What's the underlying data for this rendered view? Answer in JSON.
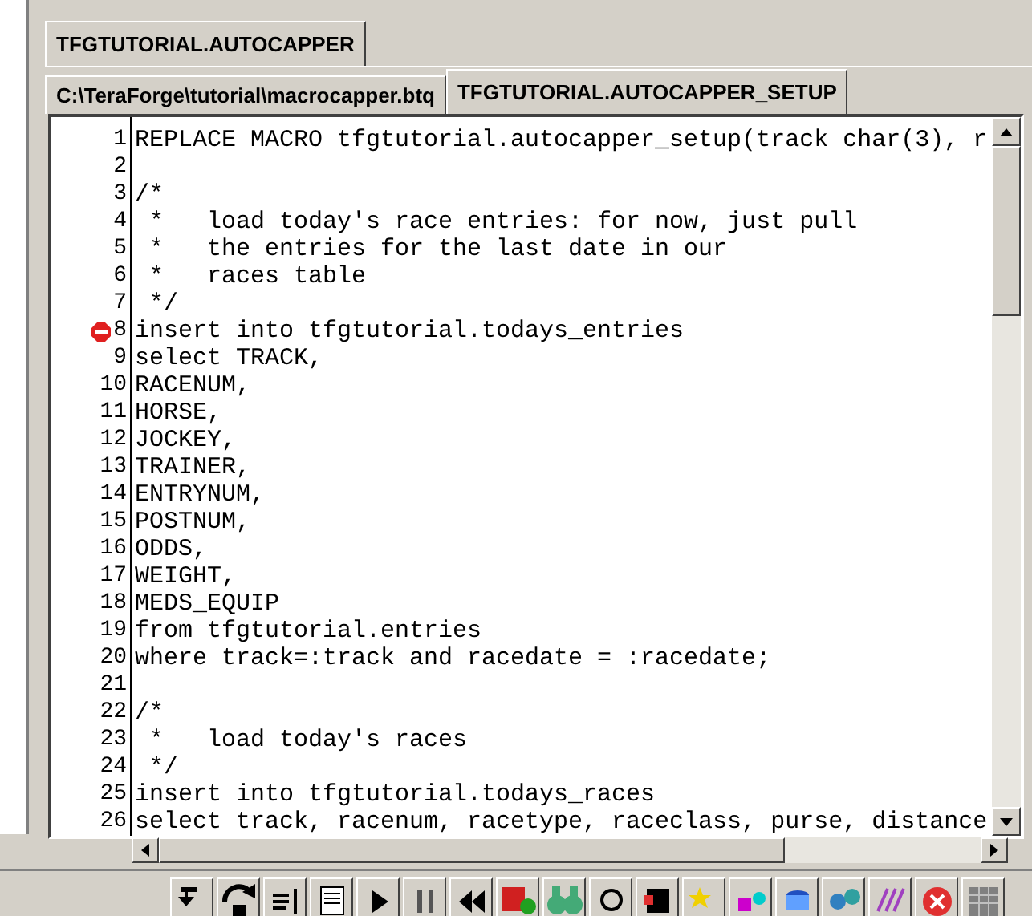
{
  "outer_tabs": [
    {
      "label": "TFGTUTORIAL.AUTOCAPPER",
      "selected": true
    }
  ],
  "editor_tabs": [
    {
      "label": "C:\\TeraForge\\tutorial\\macrocapper.btq",
      "selected": false
    },
    {
      "label": "TFGTUTORIAL.AUTOCAPPER_SETUP",
      "selected": true
    }
  ],
  "lines": [
    {
      "number": "1",
      "text": "REPLACE MACRO tfgtutorial.autocapper_setup(track char(3), r",
      "breakpoint": false
    },
    {
      "number": "2",
      "breakpoint": false
    },
    {
      "number": "3",
      "text": "/*",
      "breakpoint": false
    },
    {
      "number": "4",
      "text": " *   load today's race entries: for now, just pull",
      "breakpoint": false
    },
    {
      "number": "5",
      "text": " *   the entries for the last date in our",
      "breakpoint": false
    },
    {
      "number": "6",
      "text": " *   races table",
      "breakpoint": false
    },
    {
      "number": "7",
      "text": " */",
      "breakpoint": false
    },
    {
      "number": "8",
      "text": "insert into tfgtutorial.todays_entries",
      "breakpoint": true
    },
    {
      "number": "9",
      "text": "select TRACK,",
      "breakpoint": false
    },
    {
      "number": "10",
      "text": "RACENUM,",
      "breakpoint": false
    },
    {
      "number": "11",
      "text": "HORSE,",
      "breakpoint": false
    },
    {
      "number": "12",
      "text": "JOCKEY,",
      "breakpoint": false
    },
    {
      "number": "13",
      "text": "TRAINER,",
      "breakpoint": false
    },
    {
      "number": "14",
      "text": "ENTRYNUM,",
      "breakpoint": false
    },
    {
      "number": "15",
      "text": "POSTNUM,",
      "breakpoint": false
    },
    {
      "number": "16",
      "text": "ODDS,",
      "breakpoint": false
    },
    {
      "number": "17",
      "text": "WEIGHT,",
      "breakpoint": false
    },
    {
      "number": "18",
      "text": "MEDS_EQUIP",
      "breakpoint": false
    },
    {
      "number": "19",
      "text": "from tfgtutorial.entries",
      "breakpoint": false
    },
    {
      "number": "20",
      "text": "where track=:track and racedate = :racedate;",
      "breakpoint": false
    },
    {
      "number": "21",
      "breakpoint": false
    },
    {
      "number": "22",
      "text": "/*",
      "breakpoint": false
    },
    {
      "number": "23",
      "text": " *   load today's races",
      "breakpoint": false
    },
    {
      "number": "24",
      "text": " */",
      "breakpoint": false
    },
    {
      "number": "25",
      "text": "insert into tfgtutorial.todays_races",
      "breakpoint": false
    },
    {
      "number": "26",
      "text": "select track, racenum, racetype, raceclass, purse, distance",
      "breakpoint": false
    }
  ]
}
